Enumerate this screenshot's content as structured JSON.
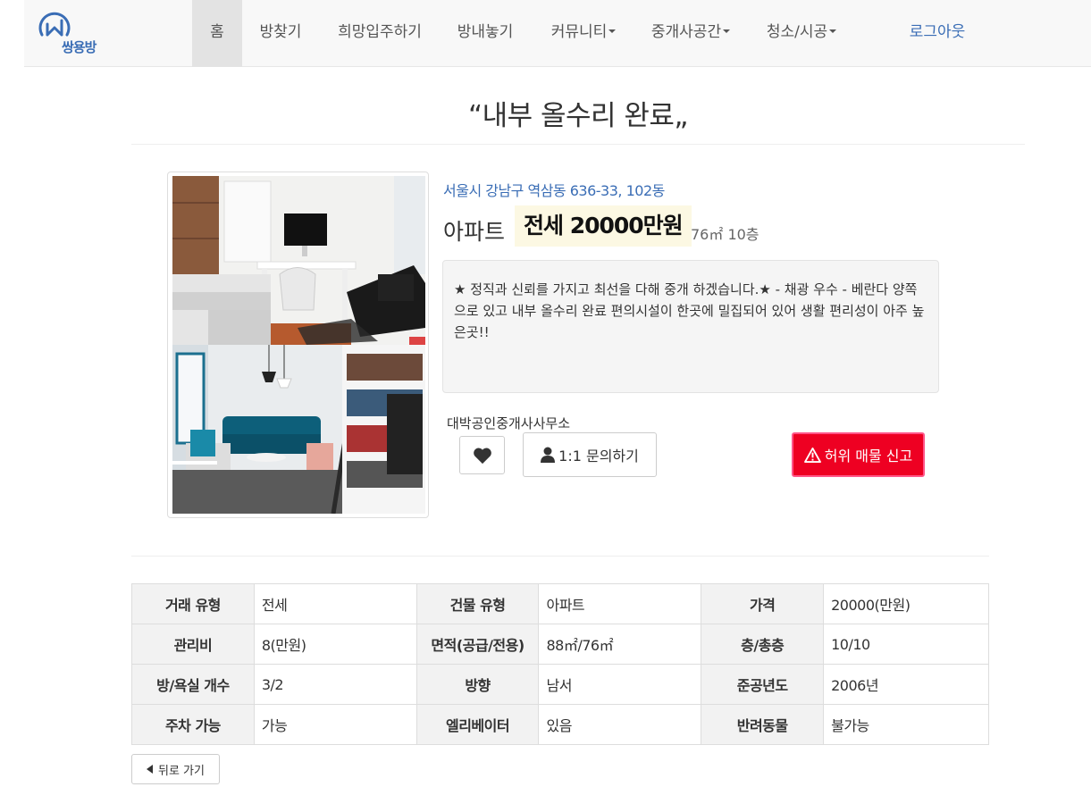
{
  "nav": {
    "logo_text": "쌍용방",
    "items": [
      "홈",
      "방찾기",
      "희망입주하기",
      "방내놓기",
      "커뮤니티",
      "중개사공간",
      "청소/시공"
    ],
    "logout": "로그아웃"
  },
  "listing": {
    "title": "“내부 올수리 완료„",
    "address": "서울시 강남구 역삼동 636-33, 102동",
    "property_type": "아파트",
    "price": "전세 20000만원",
    "area_floor": "76㎡ 10층",
    "description": "★ 정직과 신뢰를 가지고 최선을 다해 중개 하겠습니다.★ - 채광 우수 - 베란다 양쪽으로 있고 내부 올수리 완료 편의시설이 한곳에 밀집되어 있어 생활 편리성이 아주 높은곳!!",
    "agency": "대박공인중개사사무소"
  },
  "actions": {
    "inquiry": "1:1 문의하기",
    "report": "허위 매물 신고",
    "back": "뒤로 가기"
  },
  "details": [
    [
      {
        "label": "거래 유형",
        "value": "전세"
      },
      {
        "label": "건물 유형",
        "value": "아파트"
      },
      {
        "label": "가격",
        "value": "20000(만원)"
      }
    ],
    [
      {
        "label": "관리비",
        "value": "8(만원)"
      },
      {
        "label": "면적(공급/전용)",
        "value": "88㎡/76㎡"
      },
      {
        "label": "층/총층",
        "value": "10/10"
      }
    ],
    [
      {
        "label": "방/욕실 개수",
        "value": "3/2"
      },
      {
        "label": "방향",
        "value": "남서"
      },
      {
        "label": "준공년도",
        "value": "2006년"
      }
    ],
    [
      {
        "label": "주차 가능",
        "value": "가능"
      },
      {
        "label": "엘리베이터",
        "value": "있음"
      },
      {
        "label": "반려동물",
        "value": "불가능"
      }
    ]
  ],
  "icons": {
    "heart": "heart-icon",
    "user": "user-icon",
    "warning": "warning-icon",
    "back": "triangle-left-icon"
  },
  "colors": {
    "link_blue": "#3a6db5",
    "price_highlight": "#fcf8e3",
    "report_red": "#ee0022"
  }
}
